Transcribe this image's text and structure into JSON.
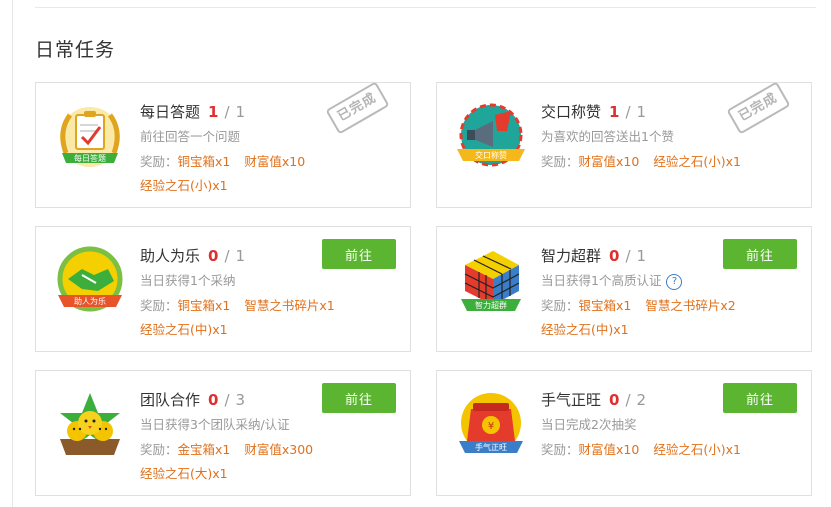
{
  "section": {
    "title": "日常任务"
  },
  "colors": {
    "accent_green": "#5cb531",
    "progress_red": "#e02f2f",
    "reward_orange": "#e0701a"
  },
  "tasks": [
    {
      "title": "每日答题",
      "current": "1",
      "sep": "/",
      "total": "1",
      "desc": "前往回答一个问题",
      "reward_label": "奖励：",
      "rewards": [
        "铜宝箱x1",
        "财富值x10",
        "经验之石(小)x1"
      ],
      "badge_icon": "daily-answer-icon",
      "badge_text": "每日答题",
      "status": "completed",
      "stamp_text": "已完成"
    },
    {
      "title": "交口称赞",
      "current": "1",
      "sep": "/",
      "total": "1",
      "desc": "为喜欢的回答送出1个赞",
      "reward_label": "奖励：",
      "rewards": [
        "财富值x10",
        "经验之石(小)x1"
      ],
      "badge_icon": "megaphone-icon",
      "badge_text": "交口称赞",
      "status": "completed",
      "stamp_text": "已完成"
    },
    {
      "title": "助人为乐",
      "current": "0",
      "sep": "/",
      "total": "1",
      "desc": "当日获得1个采纳",
      "reward_label": "奖励：",
      "rewards": [
        "铜宝箱x1",
        "智慧之书碎片x1",
        "经验之石(中)x1"
      ],
      "badge_icon": "handshake-icon",
      "badge_text": "助人为乐",
      "status": "todo",
      "button_label": "前往"
    },
    {
      "title": "智力超群",
      "current": "0",
      "sep": "/",
      "total": "1",
      "desc": "当日获得1个高质认证",
      "help": "?",
      "reward_label": "奖励：",
      "rewards": [
        "银宝箱x1",
        "智慧之书碎片x2",
        "经验之石(中)x1"
      ],
      "badge_icon": "rubik-cube-icon",
      "badge_text": "智力超群",
      "status": "todo",
      "button_label": "前往"
    },
    {
      "title": "团队合作",
      "current": "0",
      "sep": "/",
      "total": "3",
      "desc": "当日获得3个团队采纳/认证",
      "reward_label": "奖励：",
      "rewards": [
        "金宝箱x1",
        "财富值x300",
        "经验之石(大)x1"
      ],
      "badge_icon": "team-chicks-icon",
      "badge_text": "",
      "status": "todo",
      "button_label": "前往"
    },
    {
      "title": "手气正旺",
      "current": "0",
      "sep": "/",
      "total": "2",
      "desc": "当日完成2次抽奖",
      "reward_label": "奖励：",
      "rewards": [
        "财富值x10",
        "经验之石(小)x1"
      ],
      "badge_icon": "lucky-bag-icon",
      "badge_text": "手气正旺",
      "status": "todo",
      "button_label": "前往"
    }
  ]
}
